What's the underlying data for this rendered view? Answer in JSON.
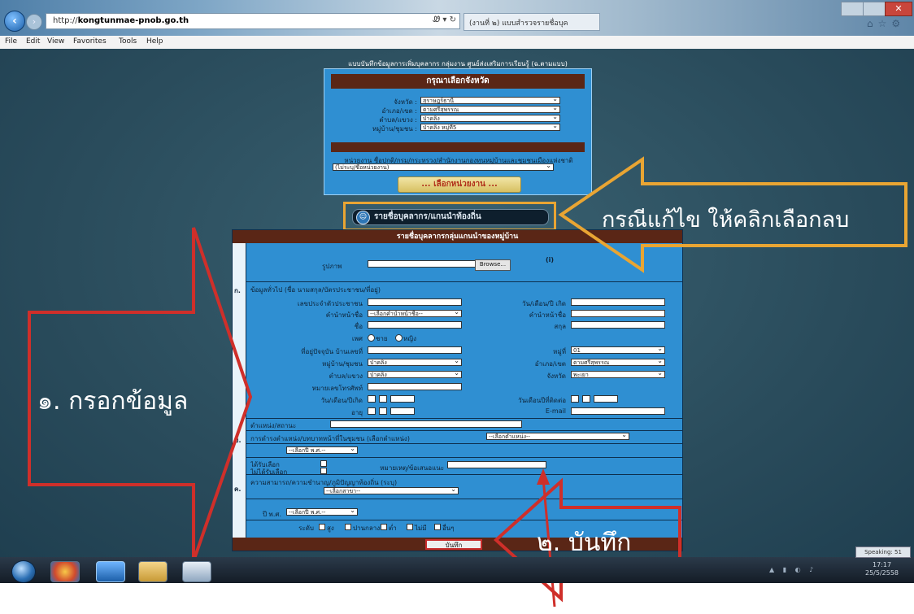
{
  "browser": {
    "url_prefix": "http://",
    "domain": "kongtunmae-pnob.go.th",
    "url_suffix": "",
    "address_tools": "Ꮺ ▾ ↻",
    "tab_title": "(งานที่ ๒) แบบสำรวจรายชื่อบุค",
    "back_icon": "arrow-left-icon",
    "close_label": "✕"
  },
  "menu": [
    "File",
    "Edit",
    "View",
    "Favorites",
    "Tools",
    "Help"
  ],
  "top_form": {
    "header": "แบบบันทึกข้อมูลการเพิ่มบุคลากร กลุ่มงาน ศูนย์ส่งเสริมการเรียนรู้ (ฉ.ตามแบบ)",
    "panel_title": "กรุณาเลือกจังหวัด",
    "fields": [
      {
        "label": "จังหวัด :",
        "value": "สุราษฎร์ธานี"
      },
      {
        "label": "อำเภอ/เขต :",
        "value": "ตามศรีสุพรรณ"
      },
      {
        "label": "ตำบล/แขวง :",
        "value": "ป่าคลิง"
      },
      {
        "label": "หมู่บ้าน/ชุมชน :",
        "value": "ป่าคลิง หมู่ที่5"
      }
    ],
    "agency_label": "หน่วยงาน ชื่อปกติ/กรม/กระทรวง/สำนักงานกองทุนหมู่บ้านและชุมชนเมืองแห่งชาติ",
    "agency_value": "(ไม่ระบุ/ชื่อหน่วยงาน)",
    "load_button": "... เลือกหน่วยงาน ..."
  },
  "delete_button": "รายชื่อบุคลากร/แกนนำท้องถิ่น",
  "main_form": {
    "title": "รายชื่อบุคลากรกลุ่มแกนนำของหมู่บ้าน",
    "photo_label": "รูปภาพ",
    "photo_marker": "(i)",
    "browse_label": "Browse...",
    "section_a_number": "ก.",
    "section_a_head": "ข้อมูลทั่วไป (ชื่อ นามสกุล/บัตรประชาชน/ที่อยู่)",
    "section_b_number": "ข.",
    "section_b_head": "การดำรงตำแหน่ง/บทบาทหน้าที่ในชุมชน (เลือกตำแหน่ง)",
    "section_c_number": "ค.",
    "section_c_head": "ความสามารถ/ความชำนาญ/ภูมิปัญญาท้องถิ่น (ระบุ)",
    "left_labels": [
      "เลขประจำตัวประชาชน",
      "คำนำหน้าชื่อ",
      "ชื่อ",
      "เพศ",
      "ที่อยู่ปัจจุบัน บ้านเลขที่",
      "หมู่บ้าน/ชุมชน",
      "ตำบล/แขวง",
      "หมายเลขโทรศัพท์",
      "วัน/เดือน/ปีเกิด",
      "อายุ"
    ],
    "right_labels": [
      "วัน/เดือน/ปี เกิด",
      "คำนำหน้าชื่อ",
      "สกุล",
      "",
      "หมู่ที่",
      "อำเภอ/เขต",
      "จังหวัด",
      "",
      "วันเดือนปีที่ติดต่อ",
      "E-mail"
    ],
    "title_select": "--เลือกคำนำหน้าชื่อ--",
    "gender_options": [
      "ชาย",
      "หญิง"
    ],
    "village_values": [
      "ป่าคลิง",
      "ป่าคลิง"
    ],
    "right_selects": [
      "01",
      "ตามศรีสุพรรณ",
      "พะเยา"
    ],
    "org_label": "ตำแหน่ง/สถานะ",
    "org_select": "--เลือกตำแหน่ง--",
    "year_select": "--เลือกปี พ.ศ.--",
    "year_label": "ปี พ.ศ.",
    "year_select_2": "--เลือกปี พ.ศ.--",
    "status_labels": [
      "ได้รับเลือก",
      "ไม่ได้รับเลือก"
    ],
    "remark_label": "หมายเหตุ/ข้อเสนอแนะ",
    "skill_select": "--เลือกสาขา--",
    "checkbox_label": "ระดับ",
    "checkbox_items": [
      "สูง",
      "ปานกลาง",
      "ต่ำ",
      "ไม่มี",
      "อื่นๆ"
    ],
    "save_button": "บันทึก"
  },
  "annotations": {
    "fill_data": "๑. กรอกข้อมูล",
    "edit_delete": "กรณีแก้ไข ให้คลิกเลือกลบ",
    "save": "๒. บันทึก",
    "colors": {
      "red": "#cf2f2a",
      "orange": "#e9a533"
    }
  },
  "taskbar": {
    "clock_time": "17:17",
    "clock_date": "25/5/2558",
    "badge": "Speaking: 51"
  }
}
